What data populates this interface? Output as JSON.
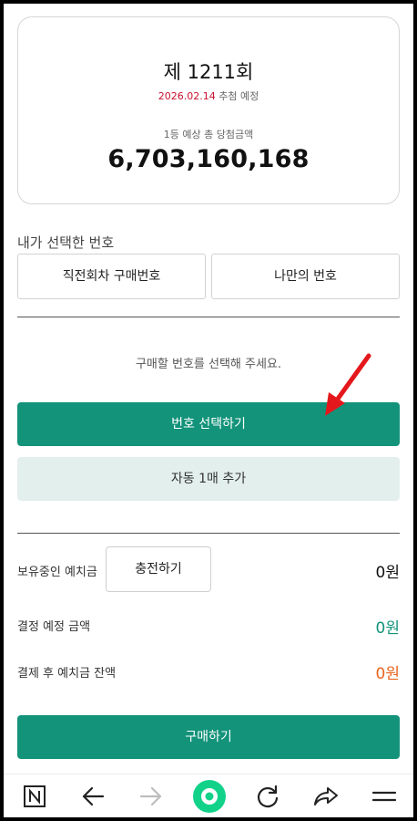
{
  "draw": {
    "title": "제 1211회",
    "date": "2026.02.14",
    "date_suffix": " 추첨 예정",
    "prize_label": "1등 예상 총 당첨금액",
    "prize_amount": "6,703,160,168"
  },
  "my_numbers": {
    "label": "내가 선택한 번호",
    "previous_button": "직전회차 구매번호",
    "custom_button": "나만의 번호"
  },
  "selection": {
    "hint": "구매할 번호를 선택해 주세요.",
    "select_button": "번호 선택하기",
    "auto_button": "자동 1매 추가"
  },
  "balance": {
    "deposit_label": "보유중인 예치금",
    "charge_button": "충전하기",
    "deposit_value": "0원",
    "payment_label": "결정 예정 금액",
    "payment_value": "0원",
    "remaining_label": "결제 후 예치금 잔액",
    "remaining_value": "0원"
  },
  "purchase_button": "구매하기",
  "colors": {
    "primary": "#12937a",
    "secondary_bg": "#e3efec",
    "date_red": "#c8102e",
    "payment_teal": "#12937a",
    "remaining_orange": "#e8641e",
    "annotation_arrow": "#e4181c"
  },
  "browser_nav": {
    "icons": [
      "naver-n-icon",
      "back-arrow-icon",
      "forward-arrow-icon",
      "home-circle-icon",
      "refresh-icon",
      "share-icon",
      "menu-icon"
    ]
  }
}
